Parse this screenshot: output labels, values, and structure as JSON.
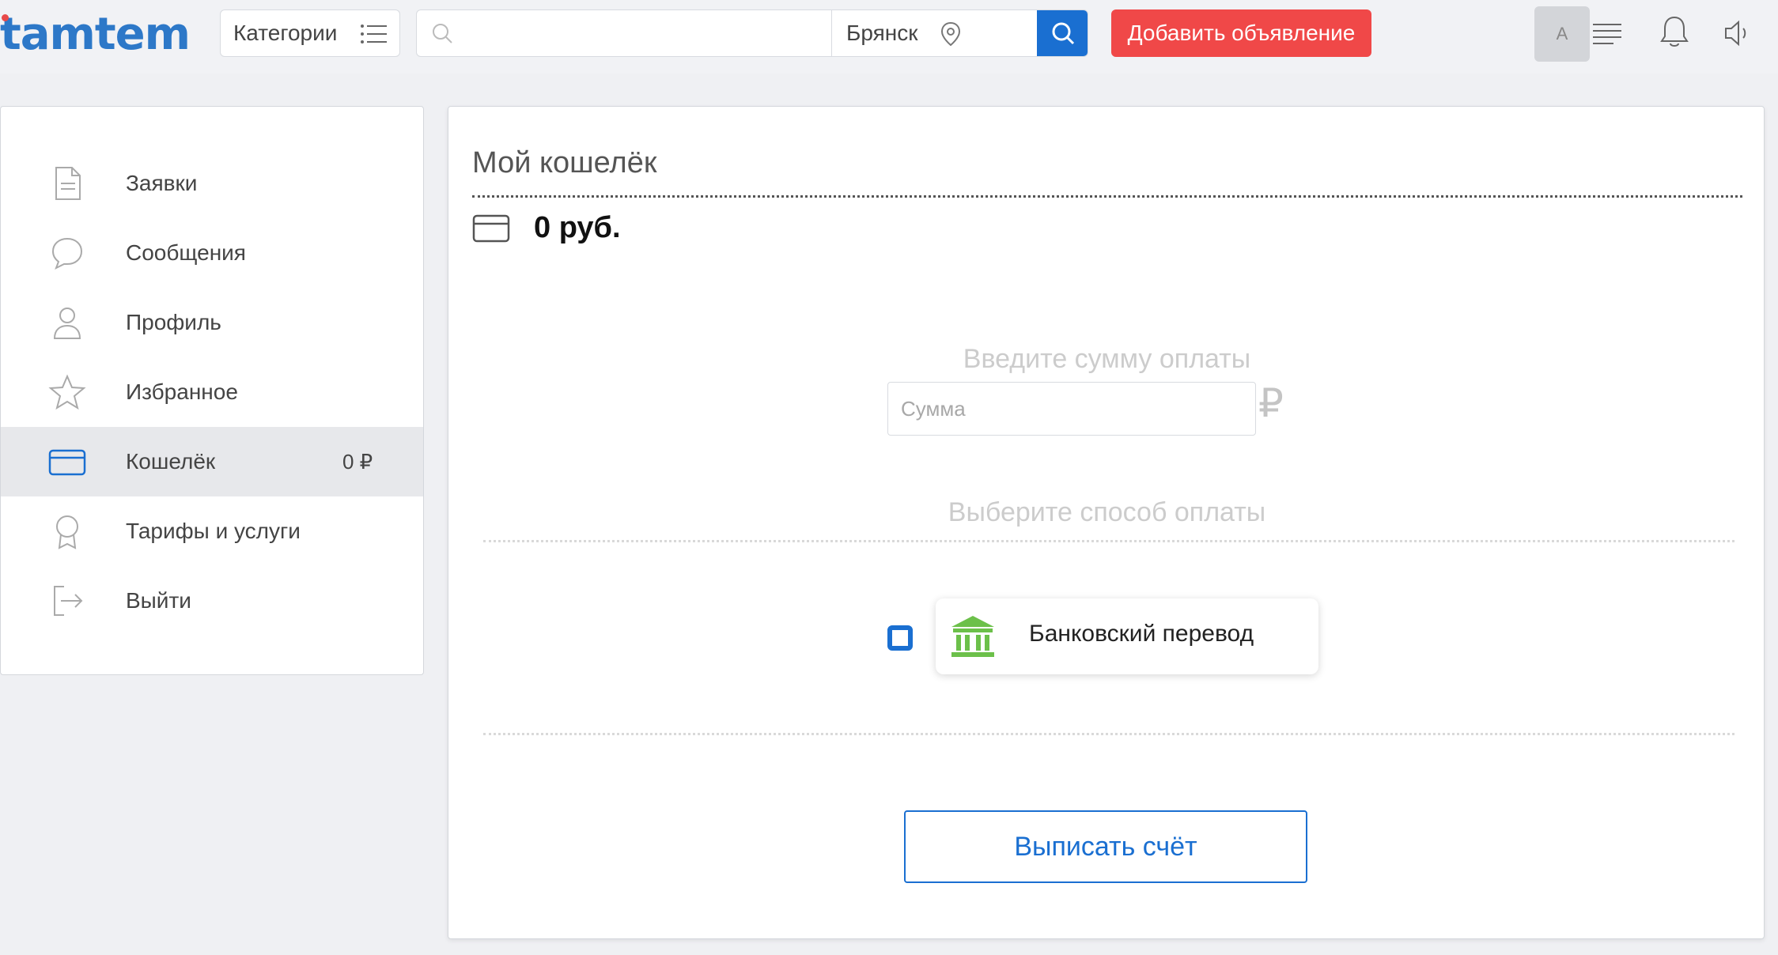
{
  "header": {
    "logo": "tamtem",
    "categories_label": "Категории",
    "search_placeholder": "",
    "city": "Брянск",
    "add_ad_label": "Добавить объявление",
    "avatar_letter": "A"
  },
  "colors": {
    "accent": "#1a6fd1",
    "add_button": "#f04848",
    "bank_icon": "#6cc04a",
    "logo": "#2d78c8"
  },
  "sidebar": {
    "items": [
      {
        "label": "Заявки",
        "icon": "document-icon"
      },
      {
        "label": "Сообщения",
        "icon": "chat-bubble-icon"
      },
      {
        "label": "Профиль",
        "icon": "user-icon"
      },
      {
        "label": "Избранное",
        "icon": "star-icon"
      },
      {
        "label": "Кошелёк",
        "icon": "wallet-card-icon",
        "balance": "0 ₽",
        "active": true
      },
      {
        "label": "Тарифы и услуги",
        "icon": "award-icon"
      },
      {
        "label": "Выйти",
        "icon": "logout-icon"
      }
    ]
  },
  "wallet": {
    "title": "Мой кошелёк",
    "balance": "0 руб.",
    "amount_label": "Введите сумму оплаты",
    "amount_placeholder": "Сумма",
    "currency_sign": "₽",
    "method_label": "Выберите способ оплаты",
    "methods": [
      {
        "name": "Банковский перевод",
        "icon": "bank-icon",
        "selected": true
      }
    ],
    "invoice_button": "Выписать счёт"
  }
}
